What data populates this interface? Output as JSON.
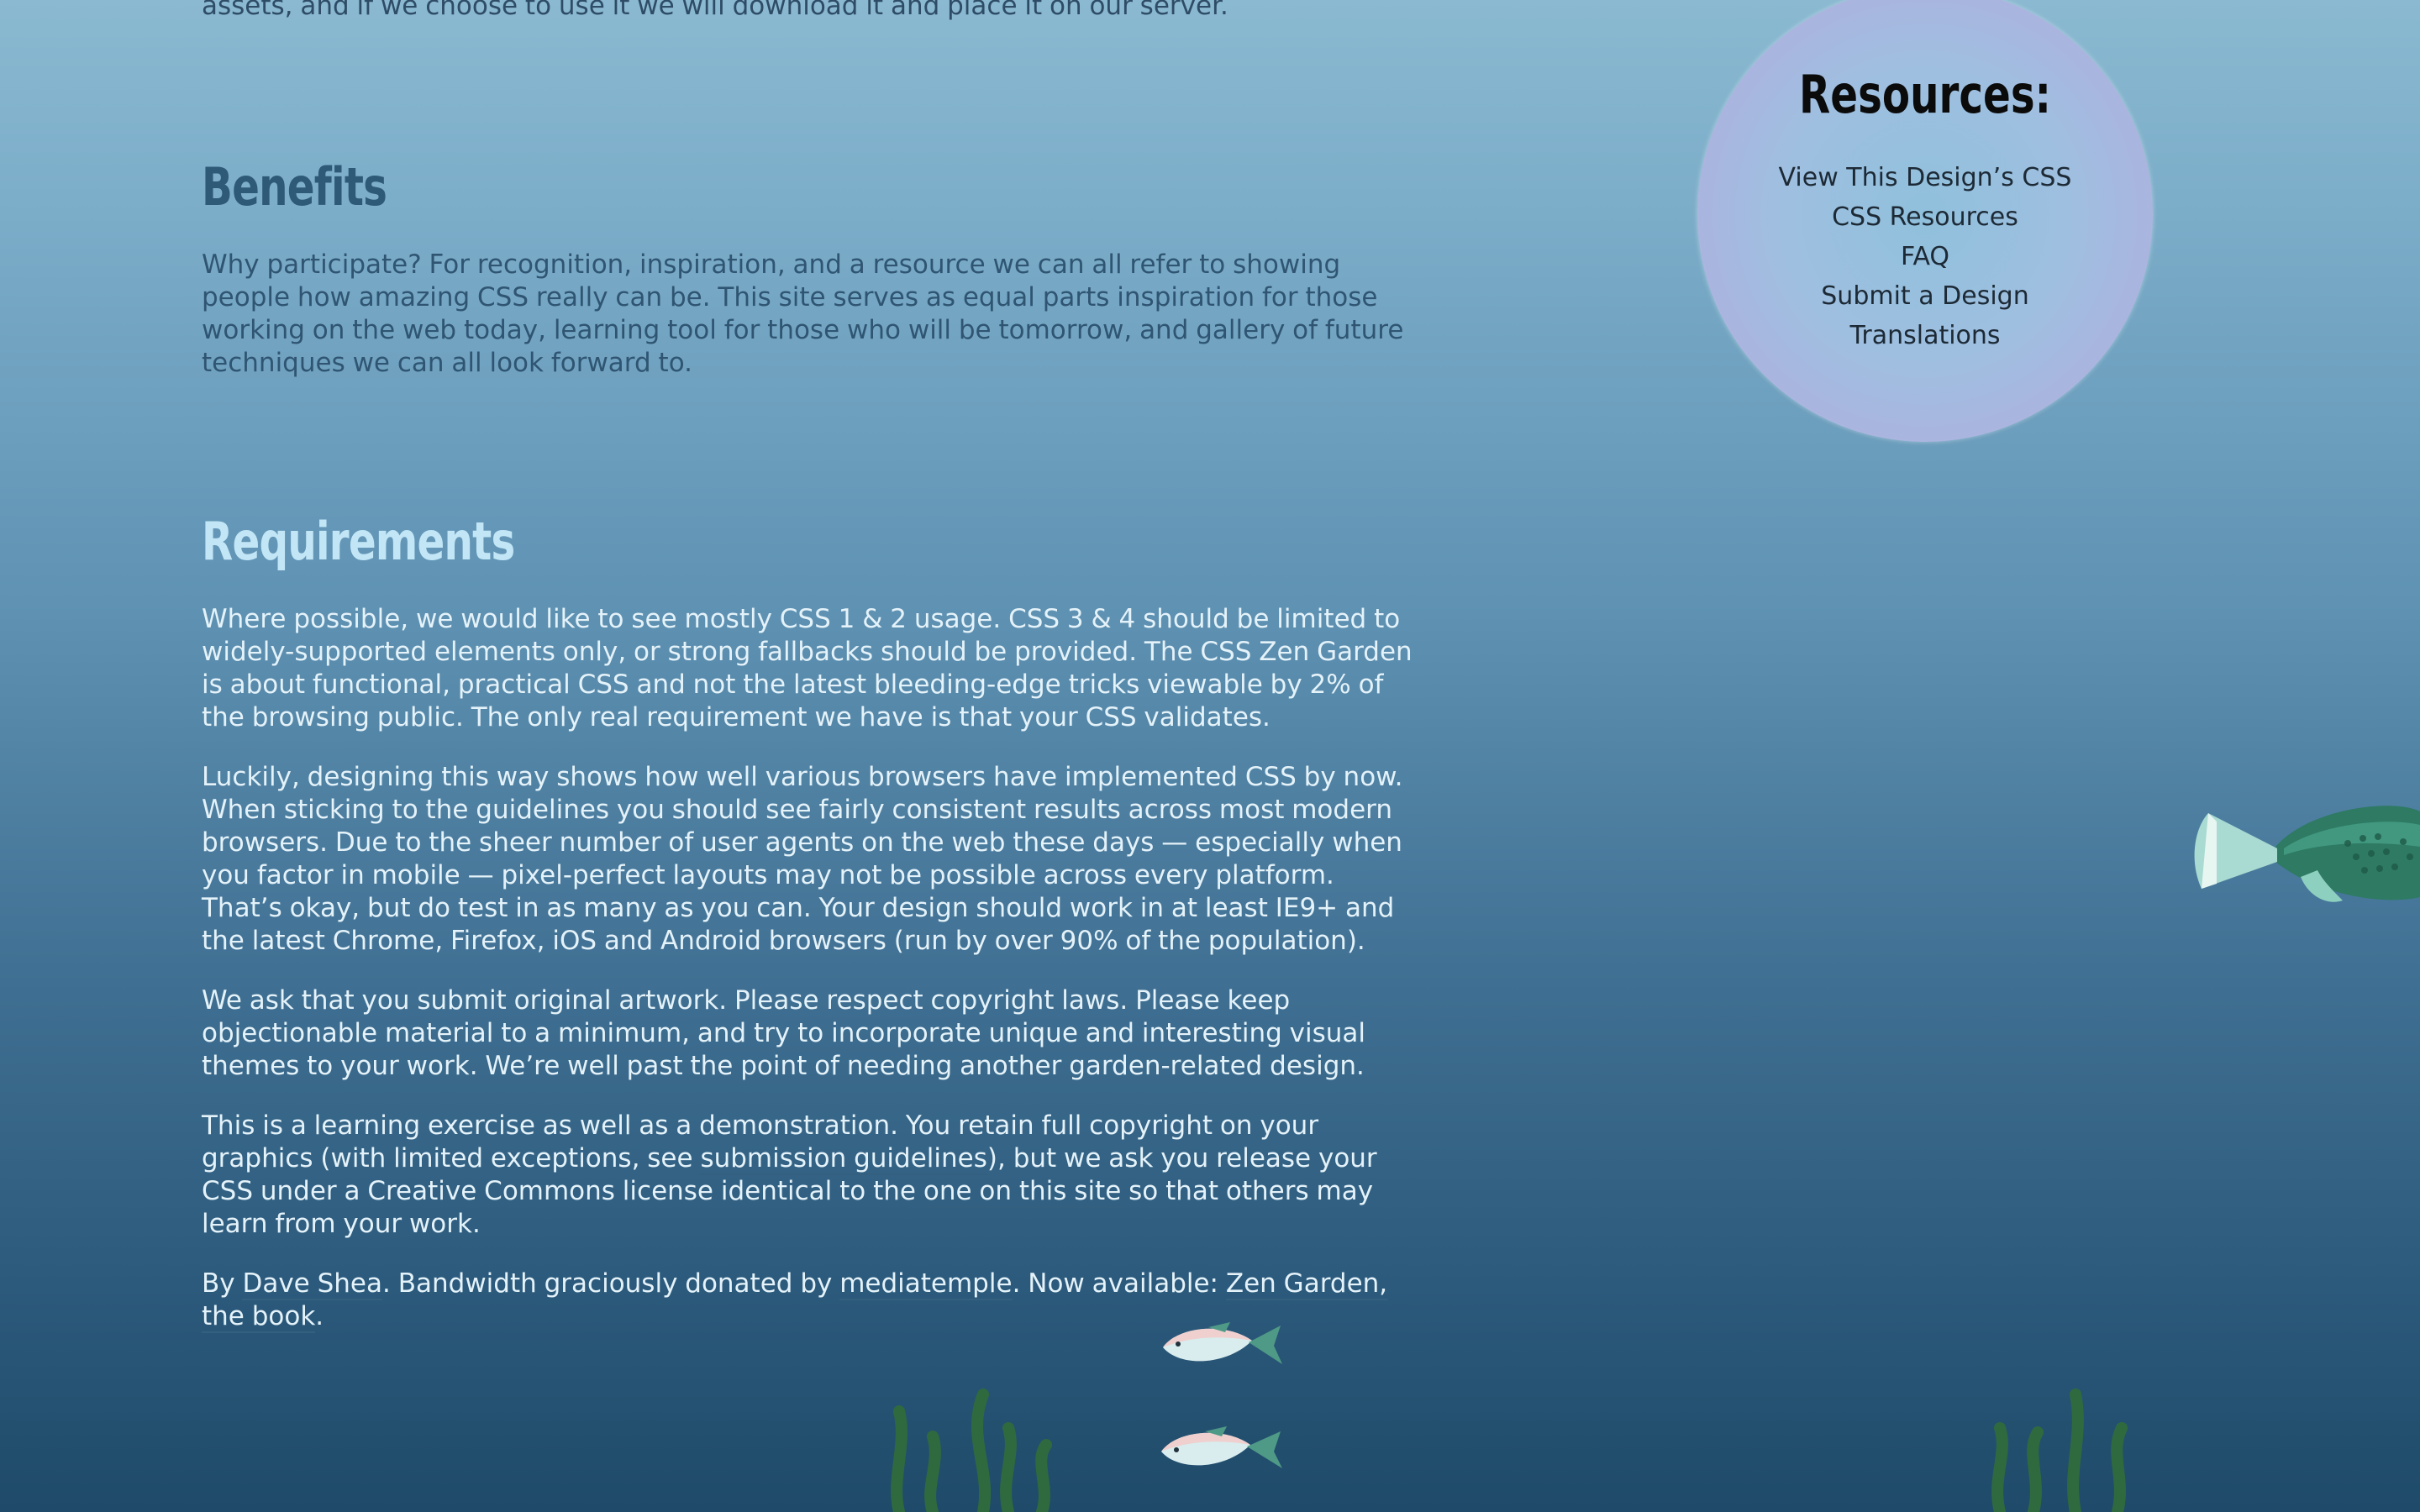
{
  "intro": {
    "tail_text": "assets, and if we choose to use it we will download it and place it on our server."
  },
  "benefits": {
    "heading": "Benefits",
    "text": "Why participate? For recognition, inspiration, and a resource we can all refer to showing people how amazing CSS really can be. This site serves as equal parts inspiration for those working on the web today, learning tool for those who will be tomorrow, and gallery of future techniques we can all look forward to."
  },
  "requirements": {
    "heading": "Requirements",
    "p1": "Where possible, we would like to see mostly CSS 1 & 2 usage. CSS 3 & 4 should be limited to widely-supported elements only, or strong fallbacks should be provided. The CSS Zen Garden is about functional, practical CSS and not the latest bleeding-edge tricks viewable by 2% of the browsing public. The only real requirement we have is that your CSS validates.",
    "p2": "Luckily, designing this way shows how well various browsers have implemented CSS by now. When sticking to the guidelines you should see fairly consistent results across most modern browsers. Due to the sheer number of user agents on the web these days — especially when you factor in mobile — pixel-perfect layouts may not be possible across every platform. That’s okay, but do test in as many as you can. Your design should work in at least IE9+ and the latest Chrome, Firefox, iOS and Android browsers (run by over 90% of the population).",
    "p3": "We ask that you submit original artwork. Please respect copyright laws. Please keep objectionable material to a minimum, and try to incorporate unique and interesting visual themes to your work. We’re well past the point of needing another garden-related design.",
    "p4": {
      "before_link1": "This is a learning exercise as well as a demonstration. You retain full copyright on your graphics (with limited exceptions, see ",
      "link1": "submission guidelines",
      "between": "), but we ask you release your CSS under a Creative Commons license identical to the ",
      "link2": "one on this site",
      "after": " so that others may learn from your work."
    },
    "p5": {
      "by": "By ",
      "author": "Dave Shea",
      "bandwidth": ". Bandwidth graciously donated by ",
      "host": "mediatemple",
      "available": ". Now available: ",
      "book": "Zen Garden, the book",
      "end": "."
    }
  },
  "resources": {
    "title": "Resources:",
    "items": [
      "View This Design’s CSS",
      "CSS Resources",
      "FAQ",
      "Submit a Design",
      "Translations"
    ]
  },
  "decorations": {
    "big_fish_icon": "fish-icon",
    "small_fish_icon": "small-fish-icon",
    "seaweed_icon": "seaweed-icon",
    "colors": {
      "big_fish": "#2e7a63",
      "small_fish": "#d9ecee",
      "seaweed": "#2f6a3f"
    }
  }
}
